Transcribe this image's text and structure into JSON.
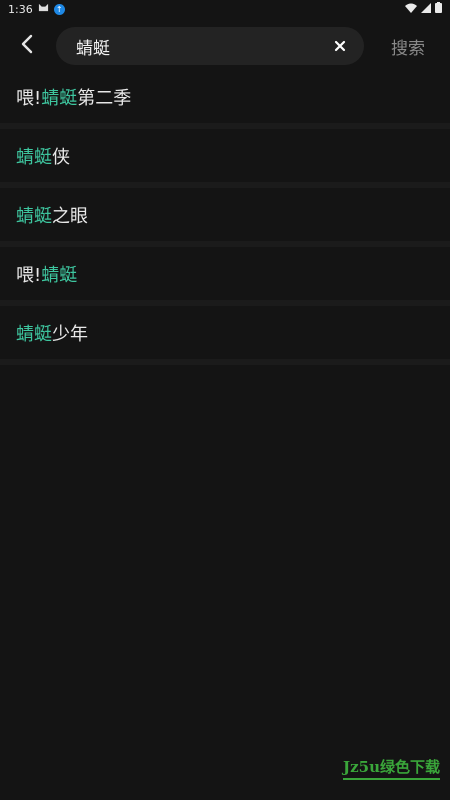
{
  "status_bar": {
    "time": "1:36"
  },
  "search": {
    "query": "蜻蜓",
    "submit_label": "搜索"
  },
  "results": [
    {
      "before": "喂! ",
      "highlight": "蜻蜓",
      "after": "第二季"
    },
    {
      "before": "",
      "highlight": "蜻蜓",
      "after": "侠"
    },
    {
      "before": "",
      "highlight": "蜻蜓",
      "after": "之眼"
    },
    {
      "before": "喂! ",
      "highlight": "蜻蜓",
      "after": ""
    },
    {
      "before": "",
      "highlight": "蜻蜓",
      "after": "少年"
    }
  ],
  "watermark": "Jz5u绿色下载",
  "colors": {
    "background": "#141414",
    "highlight": "#3ec7a0",
    "search_box": "#232323",
    "submit_text": "#8a8a8a"
  },
  "icons": {
    "back": "chevron-left-icon",
    "clear": "close-icon",
    "wifi": "wifi-icon",
    "signal": "signal-icon",
    "battery": "battery-icon"
  }
}
